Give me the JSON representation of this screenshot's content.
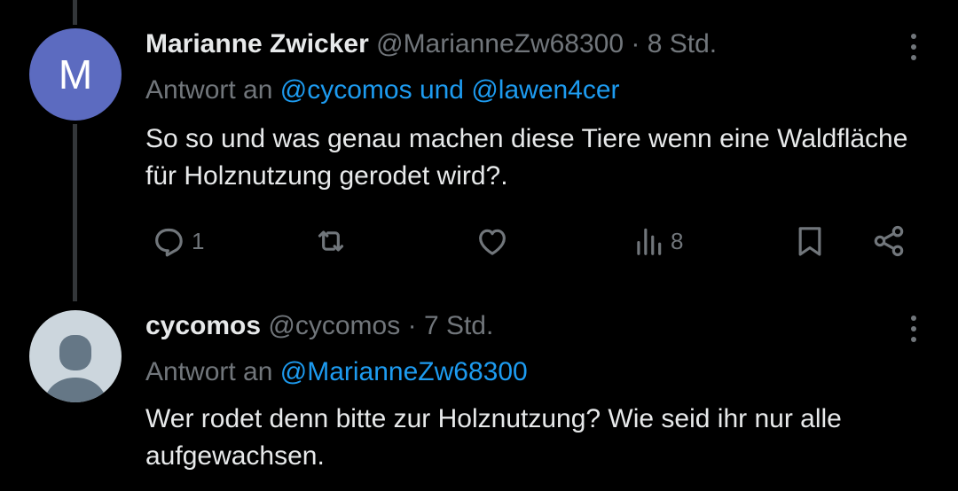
{
  "thread": [
    {
      "avatar_letter": "M",
      "avatar_color": "#5c6bc0",
      "display_name": "Marianne Zwicker",
      "handle": "@MarianneZw68300",
      "separator": "·",
      "time": "8 Std.",
      "reply_prefix": "Antwort an",
      "reply_mention_1": "@cycomos",
      "reply_joiner": "und",
      "reply_mention_2": "@lawen4cer",
      "text": "So so und was genau machen diese Tiere wenn eine Waldfläche für Holznutzung gerodet wird?.",
      "reply_count": "1",
      "views_count": "8"
    },
    {
      "avatar_color": "#ccd6dd",
      "display_name": "cycomos",
      "handle": "@cycomos",
      "separator": "·",
      "time": "7 Std.",
      "reply_prefix": "Antwort an",
      "reply_mention_1": "@MarianneZw68300",
      "text": "Wer rodet denn bitte zur Holznutzung? Wie seid ihr nur alle aufgewachsen."
    }
  ],
  "icons": {
    "reply": "reply-icon",
    "retweet": "retweet-icon",
    "like": "heart-icon",
    "views": "views-icon",
    "bookmark": "bookmark-icon",
    "share": "share-icon",
    "more": "more-vertical-icon"
  },
  "colors": {
    "background": "#000000",
    "text": "#e7e9ea",
    "muted": "#71767b",
    "link": "#1d9bf0"
  }
}
